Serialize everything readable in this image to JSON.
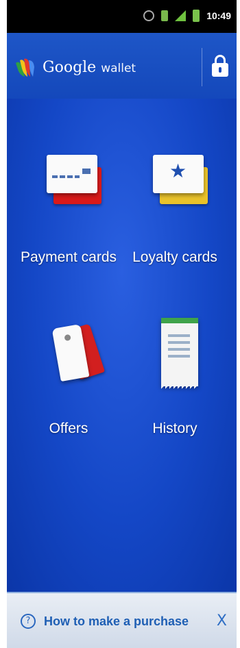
{
  "status_bar": {
    "time": "10:49",
    "icons": [
      "sync-icon",
      "vibrate-icon",
      "signal-icon",
      "battery-icon"
    ]
  },
  "app_bar": {
    "logo_icon": "google-wallet-logo-icon",
    "title_main": "Google",
    "title_sub": "wallet",
    "lock_icon": "lock-icon"
  },
  "tiles": [
    {
      "label": "Payment cards",
      "icon": "payment-cards-icon"
    },
    {
      "label": "Loyalty cards",
      "icon": "loyalty-cards-icon"
    },
    {
      "label": "Offers",
      "icon": "offers-tag-icon"
    },
    {
      "label": "History",
      "icon": "history-receipt-icon"
    }
  ],
  "help_bar": {
    "label": "How to make a purchase",
    "help_icon_glyph": "?",
    "close_glyph": "X"
  },
  "colors": {
    "background_blue": "#1447c6",
    "status_bar": "#000000",
    "help_bar": "#dbe3ef",
    "help_text": "#1f5fb4"
  }
}
